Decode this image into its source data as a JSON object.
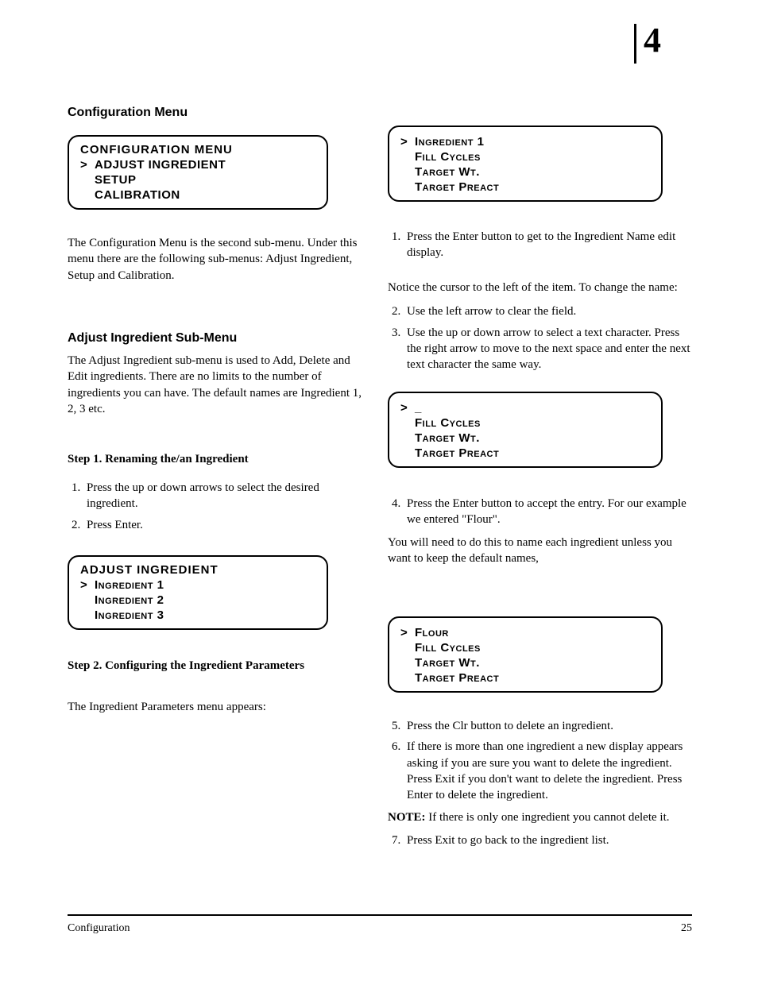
{
  "header": {
    "section_no": "4"
  },
  "lcd1": {
    "title": "CONFIGURATION MENU",
    "items": [
      "ADJUST INGREDIENT",
      "SETUP",
      "CALIBRATION"
    ],
    "cursor_index": 0
  },
  "lcd2": {
    "items": [
      "Ingredient 1",
      "Fill Cycles",
      "Target Wt.",
      "Target Preact"
    ],
    "cursor_index": 0
  },
  "lcd3": {
    "items": [
      "_",
      "Fill Cycles",
      "Target Wt.",
      "Target Preact"
    ],
    "cursor_index": 0
  },
  "lcd4": {
    "title": "ADJUST INGREDIENT",
    "items": [
      "Ingredient 1",
      "Ingredient 2",
      "Ingredient 3"
    ],
    "cursor_index": 0
  },
  "lcd5": {
    "items": [
      "Flour",
      "Fill Cycles",
      "Target Wt.",
      "Target Preact"
    ],
    "cursor_index": 0
  },
  "text": {
    "configuration_heading": "Configuration Menu",
    "configuration_body": "The Configuration Menu is the second sub-menu. Under this menu there are the following sub-menus: Adjust Ingredient, Setup and Calibration.",
    "adjust_heading": "Adjust Ingredient Sub-Menu",
    "adjust_body": "The Adjust Ingredient sub-menu is used to Add, Delete and Edit ingredients. There are no limits to the number of ingredients you can have. The default names are Ingredient 1, 2, 3 etc.",
    "renaming_heading": "Step 1. Renaming the/an Ingredient",
    "renaming_step1": "Press the up or down arrows to select the desired ingredient.",
    "renaming_step2": "Press Enter.",
    "config_heading": "Step 2. Configuring the Ingredient Parameters",
    "config_intro": "The Ingredient Parameters menu appears:",
    "config_step1": "Press the Enter button to get to the Ingredient Name edit display.",
    "config_body1": "Notice the cursor to the left of the item. To change the name:",
    "config_step2": "Use the left arrow to clear the field.",
    "config_step3": "Use the up or down arrow to select a text character. Press the right arrow to move to the next space and enter the next text character the same way.",
    "config_step4": "Press the Enter button to accept the entry. For our example we entered \"Flour\".",
    "config_body2": "You will need to do this to name each ingredient unless you want to keep the default names,",
    "config_step5": "Press the Clr button to delete an ingredient.",
    "config_step6": "If there is more than one ingredient a new display appears asking if you are sure you want to delete the ingredient. Press Exit if you don't want to delete the ingredient. Press Enter to delete the ingredient.",
    "config_note": "If there is only one ingredient you cannot delete it.",
    "config_step7": "Press Exit to go back to the ingredient list.",
    "note_label": "NOTE:"
  },
  "footer": {
    "left": "Configuration",
    "right": "25"
  }
}
